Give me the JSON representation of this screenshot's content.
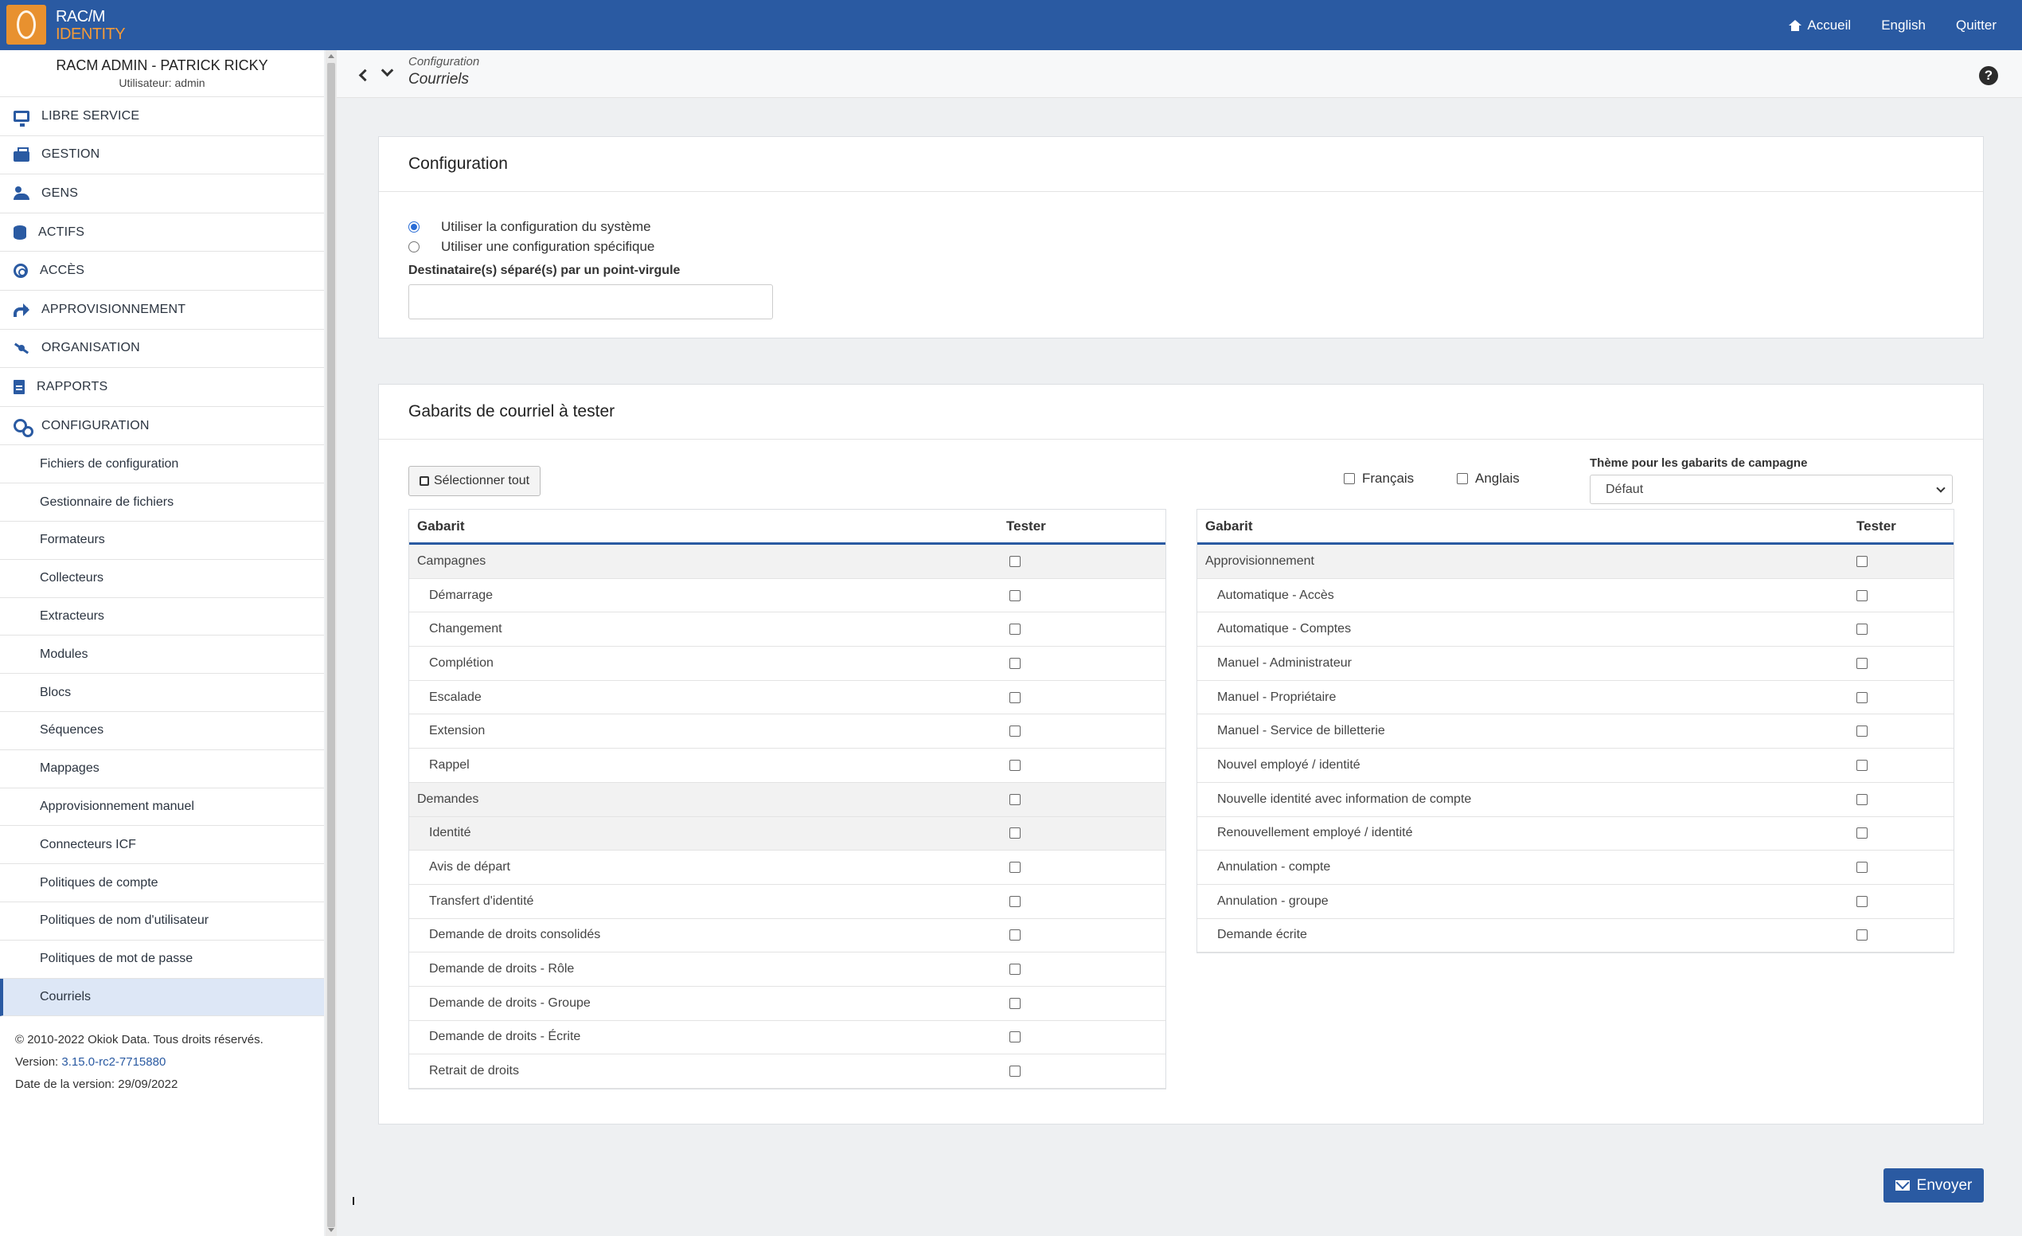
{
  "app": {
    "logo_line1": "RAC/M",
    "logo_line2": "IDENTITY"
  },
  "topnav": {
    "home": "Accueil",
    "language": "English",
    "quit": "Quitter"
  },
  "user": {
    "name": "RACM ADMIN - PATRICK RICKY",
    "role": "Utilisateur: admin"
  },
  "sidebar": {
    "items": [
      {
        "label": "LIBRE SERVICE",
        "icon": "monitor-icon"
      },
      {
        "label": "GESTION",
        "icon": "toolbox-icon"
      },
      {
        "label": "GENS",
        "icon": "users-icon"
      },
      {
        "label": "ACTIFS",
        "icon": "database-icon"
      },
      {
        "label": "ACCÈS",
        "icon": "fingerprint-icon"
      },
      {
        "label": "APPROVISIONNEMENT",
        "icon": "share-icon"
      },
      {
        "label": "ORGANISATION",
        "icon": "network-icon"
      },
      {
        "label": "RAPPORTS",
        "icon": "document-icon"
      },
      {
        "label": "CONFIGURATION",
        "icon": "cogs-icon"
      }
    ],
    "subitems": [
      "Fichiers de configuration",
      "Gestionnaire de fichiers",
      "Formateurs",
      "Collecteurs",
      "Extracteurs",
      "Modules",
      "Blocs",
      "Séquences",
      "Mappages",
      "Approvisionnement manuel",
      "Connecteurs ICF",
      "Politiques de compte",
      "Politiques de nom d'utilisateur",
      "Politiques de mot de passe",
      "Courriels"
    ],
    "active_subitem": "Courriels",
    "footer": {
      "copyright": "© 2010-2022 Okiok Data. Tous droits réservés.",
      "version_label": "Version: ",
      "version": "3.15.0-rc2-7715880",
      "date": "Date de la version: 29/09/2022"
    }
  },
  "breadcrumb": {
    "parent": "Configuration",
    "current": "Courriels"
  },
  "config_panel": {
    "title": "Configuration",
    "option_system": "Utiliser la configuration du système",
    "option_specific": "Utiliser une configuration spécifique",
    "selected_option": "system",
    "recipients_label": "Destinataire(s) séparé(s) par un point-virgule",
    "recipients_value": ""
  },
  "templates_panel": {
    "title": "Gabarits de courriel à tester",
    "select_all": "Sélectionner tout",
    "lang_fr": "Français",
    "lang_en": "Anglais",
    "theme_label": "Thème pour les gabarits de campagne",
    "theme_value": "Défaut",
    "col_template": "Gabarit",
    "col_test": "Tester",
    "left_rows": [
      {
        "label": "Campagnes",
        "type": "group"
      },
      {
        "label": "Démarrage",
        "type": "child"
      },
      {
        "label": "Changement",
        "type": "child"
      },
      {
        "label": "Complétion",
        "type": "child"
      },
      {
        "label": "Escalade",
        "type": "child"
      },
      {
        "label": "Extension",
        "type": "child"
      },
      {
        "label": "Rappel",
        "type": "child"
      },
      {
        "label": "Demandes",
        "type": "group"
      },
      {
        "label": "Identité",
        "type": "childgroup"
      },
      {
        "label": "Avis de départ",
        "type": "child"
      },
      {
        "label": "Transfert d'identité",
        "type": "child"
      },
      {
        "label": "Demande de droits consolidés",
        "type": "child"
      },
      {
        "label": "Demande de droits - Rôle",
        "type": "child"
      },
      {
        "label": "Demande de droits - Groupe",
        "type": "child"
      },
      {
        "label": "Demande de droits - Écrite",
        "type": "child"
      },
      {
        "label": "Retrait de droits",
        "type": "child"
      }
    ],
    "right_rows": [
      {
        "label": "Approvisionnement",
        "type": "group"
      },
      {
        "label": "Automatique - Accès",
        "type": "child"
      },
      {
        "label": "Automatique - Comptes",
        "type": "child"
      },
      {
        "label": "Manuel - Administrateur",
        "type": "child"
      },
      {
        "label": "Manuel - Propriétaire",
        "type": "child"
      },
      {
        "label": "Manuel - Service de billetterie",
        "type": "child"
      },
      {
        "label": "Nouvel employé / identité",
        "type": "child"
      },
      {
        "label": "Nouvelle identité avec information de compte",
        "type": "child"
      },
      {
        "label": "Renouvellement employé / identité",
        "type": "child"
      },
      {
        "label": "Annulation - compte",
        "type": "child"
      },
      {
        "label": "Annulation - groupe",
        "type": "child"
      },
      {
        "label": "Demande écrite",
        "type": "child"
      }
    ]
  },
  "send_button": "Envoyer",
  "colors": {
    "brand": "#2a5aa2",
    "accent": "#e8912f",
    "active_bg": "#dde7f6"
  }
}
